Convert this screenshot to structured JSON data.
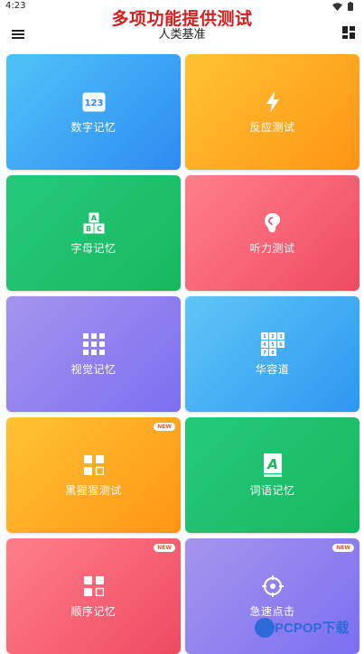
{
  "status": {
    "time": "4:23"
  },
  "overlay_title": "多项功能提供测试",
  "appbar": {
    "title": "人类基准"
  },
  "cards": [
    {
      "label": "数字记忆",
      "icon": "number-123-icon",
      "icon_text": "123",
      "gradient": "blue"
    },
    {
      "label": "反应测试",
      "icon": "lightning-icon",
      "gradient": "orange"
    },
    {
      "label": "字母记忆",
      "icon": "alphabet-blocks-icon",
      "icon_text": [
        "A",
        "B",
        "C"
      ],
      "gradient": "green"
    },
    {
      "label": "听力测试",
      "icon": "ear-icon",
      "gradient": "red"
    },
    {
      "label": "视觉记忆",
      "icon": "grid-squares-icon",
      "gradient": "purple"
    },
    {
      "label": "华容道",
      "icon": "sliding-puzzle-icon",
      "icon_text": [
        "1",
        "2",
        "3",
        "4",
        "5",
        "6",
        "7",
        "8"
      ],
      "gradient": "cyan"
    },
    {
      "label": "黑猩猩测试",
      "icon": "four-squares-icon",
      "gradient": "orange",
      "badge": "NEW"
    },
    {
      "label": "词语记忆",
      "icon": "word-book-icon",
      "icon_text": "A",
      "gradient": "green"
    },
    {
      "label": "顺序记忆",
      "icon": "sequence-squares-icon",
      "gradient": "red",
      "badge": "NEW"
    },
    {
      "label": "急速点击",
      "icon": "target-icon",
      "gradient": "purple",
      "badge": "NEW"
    }
  ],
  "watermark": {
    "text": "PCPOP",
    "suffix": "下载"
  },
  "colors": {
    "title_red": "#d21f1f",
    "brand_blue": "#2e6bd8"
  }
}
